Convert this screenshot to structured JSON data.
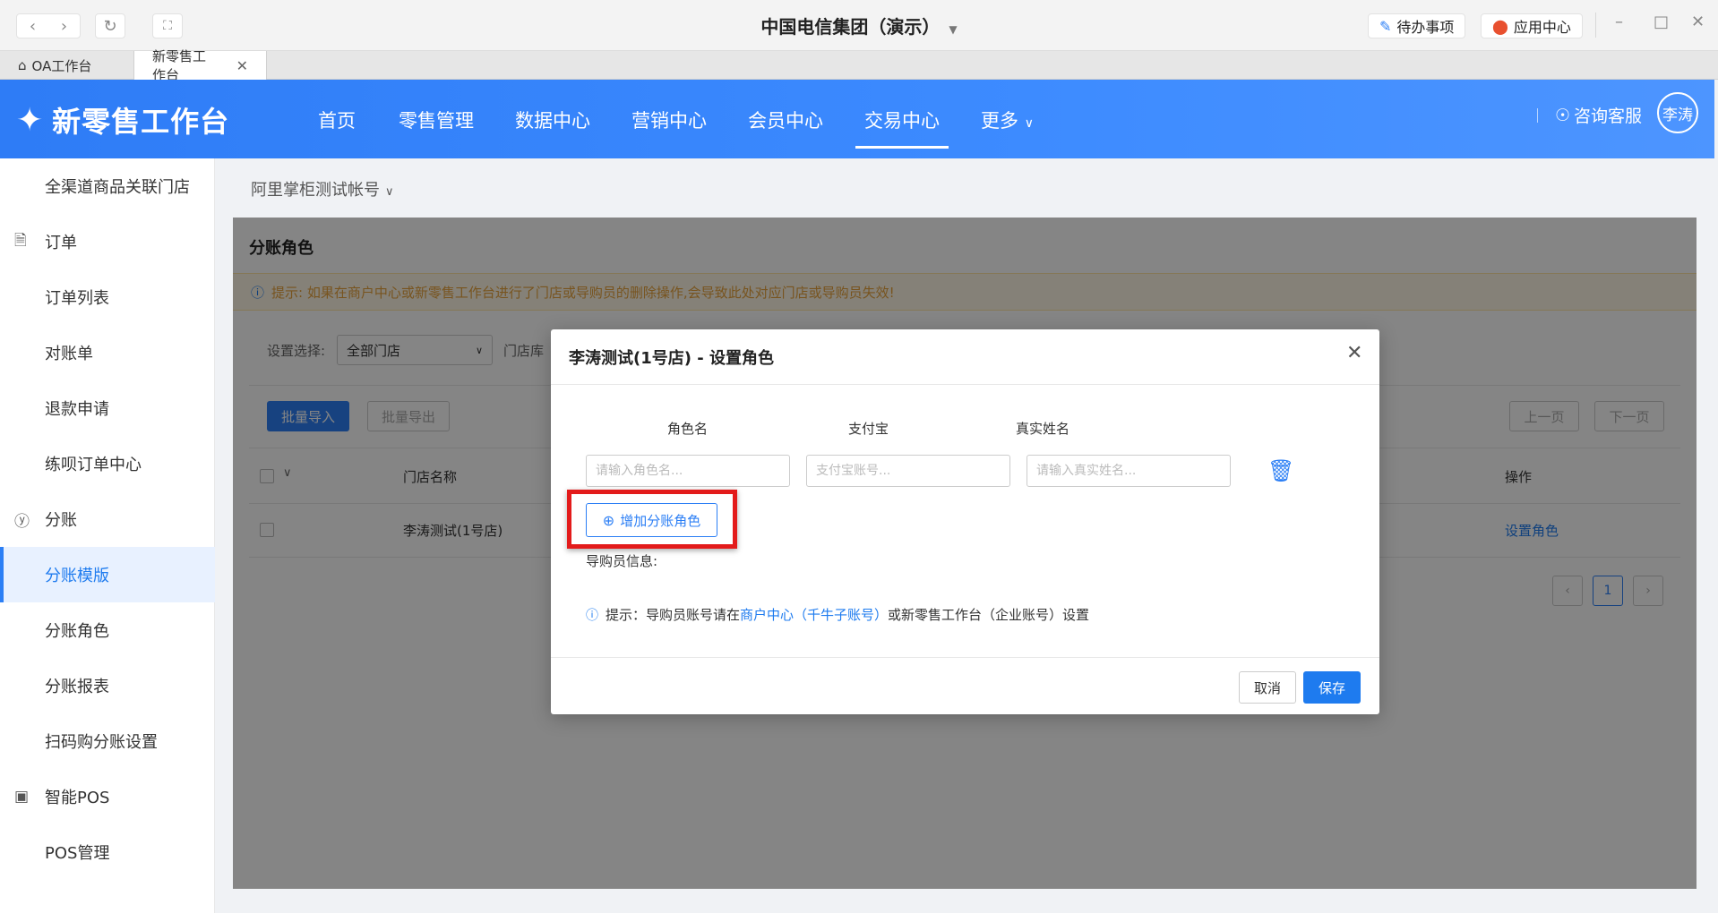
{
  "titlebar": {
    "title": "中国电信集团（演示）",
    "todo_label": "待办事项",
    "app_center_label": "应用中心"
  },
  "tabs": [
    {
      "label": "OA工作台",
      "icon": "home-icon"
    },
    {
      "label": "新零售工作台",
      "active": true
    }
  ],
  "header": {
    "logo_text": "新零售工作台",
    "nav": [
      "首页",
      "零售管理",
      "数据中心",
      "营销中心",
      "会员中心",
      "交易中心",
      "更多"
    ],
    "active_nav": "交易中心",
    "help_label": "咨询客服",
    "user_name": "李涛",
    "accent_color": "#2e7cf6"
  },
  "sidebar": {
    "items": [
      {
        "label": "全渠道商品关联门店",
        "type": "sub"
      },
      {
        "label": "订单",
        "type": "group",
        "icon": "document-icon"
      },
      {
        "label": "订单列表",
        "type": "sub"
      },
      {
        "label": "对账单",
        "type": "sub"
      },
      {
        "label": "退款申请",
        "type": "sub"
      },
      {
        "label": "练呗订单中心",
        "type": "sub"
      },
      {
        "label": "分账",
        "type": "group",
        "icon": "yen-icon"
      },
      {
        "label": "分账模版",
        "type": "sub",
        "active": true
      },
      {
        "label": "分账角色",
        "type": "sub"
      },
      {
        "label": "分账报表",
        "type": "sub"
      },
      {
        "label": "扫码购分账设置",
        "type": "sub"
      },
      {
        "label": "智能POS",
        "type": "group",
        "icon": "pos-icon"
      },
      {
        "label": "POS管理",
        "type": "sub"
      }
    ]
  },
  "content": {
    "account": "阿里掌柜测试帐号",
    "card_title": "分账角色",
    "notice": "提示: 如果在商户中心或新零售工作台进行了门店或导购员的删除操作,会导致此处对应门店或导购员失效!",
    "filter_label": "设置选择:",
    "filter_value": "全部门店",
    "store_label": "门店库",
    "import_btn": "批量导入",
    "export_btn": "批量导出",
    "prev_btn": "上一页",
    "next_btn": "下一页",
    "columns": {
      "store": "门店名称",
      "action": "操作"
    },
    "rows": [
      {
        "store": "李涛测试(1号店)",
        "action": "设置角色"
      }
    ],
    "page": "1"
  },
  "modal": {
    "title": "李涛测试(1号店) - 设置角色",
    "columns": [
      "角色名",
      "支付宝",
      "真实姓名"
    ],
    "placeholders": {
      "role": "请输入角色名...",
      "alipay": "支付宝账号...",
      "realname": "请输入真实姓名..."
    },
    "add_btn": "增加分账角色",
    "guide_label": "导购员信息:",
    "tip_prefix": "提示：导购员账号请在",
    "tip_link": "商户中心（千牛子账号）",
    "tip_suffix": "或新零售工作台（企业账号）设置",
    "cancel_btn": "取消",
    "save_btn": "保存"
  }
}
